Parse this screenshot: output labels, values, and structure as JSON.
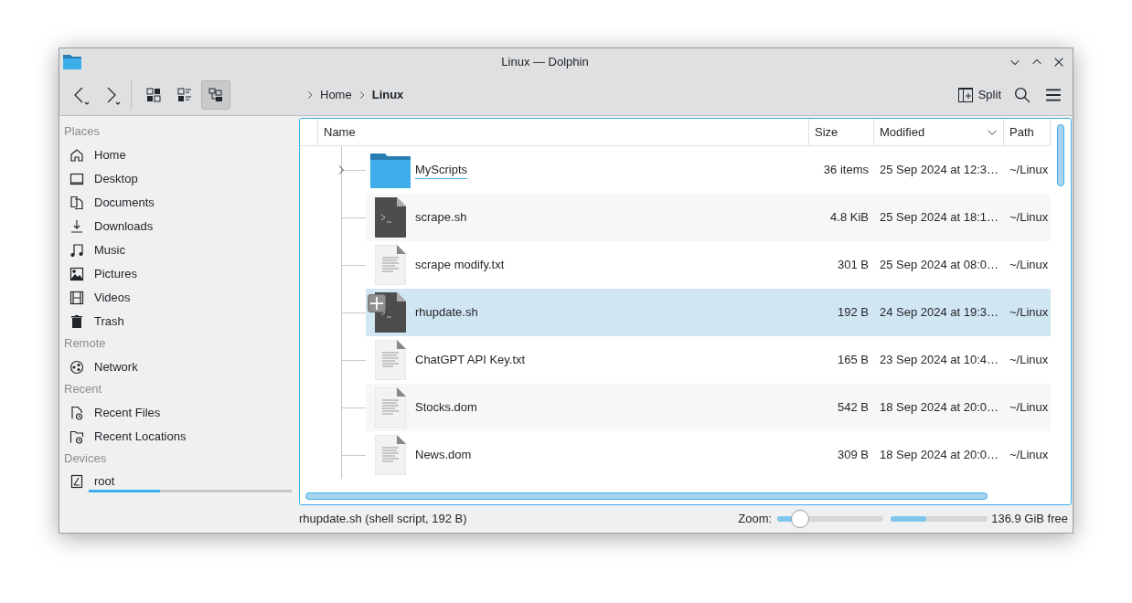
{
  "window": {
    "title": "Linux — Dolphin"
  },
  "toolbar": {
    "view_modes": [
      {
        "kind": "icons",
        "selected": false
      },
      {
        "kind": "compact",
        "selected": false
      },
      {
        "kind": "details",
        "selected": true
      }
    ],
    "breadcrumb": [
      {
        "label": "Home",
        "current": false
      },
      {
        "label": "Linux",
        "current": true
      }
    ],
    "split_label": "Split"
  },
  "sidebar": {
    "sections": [
      {
        "title": "Places",
        "items": [
          {
            "label": "Home",
            "kind": "home"
          },
          {
            "label": "Desktop",
            "kind": "desktop"
          },
          {
            "label": "Documents",
            "kind": "documents"
          },
          {
            "label": "Downloads",
            "kind": "downloads"
          },
          {
            "label": "Music",
            "kind": "music"
          },
          {
            "label": "Pictures",
            "kind": "pictures"
          },
          {
            "label": "Videos",
            "kind": "videos"
          },
          {
            "label": "Trash",
            "kind": "trash"
          }
        ]
      },
      {
        "title": "Remote",
        "items": [
          {
            "label": "Network",
            "kind": "network"
          }
        ]
      },
      {
        "title": "Recent",
        "items": [
          {
            "label": "Recent Files",
            "kind": "recent-files"
          },
          {
            "label": "Recent Locations",
            "kind": "recent-locations"
          }
        ]
      },
      {
        "title": "Devices",
        "items": [
          {
            "label": "root",
            "kind": "drive",
            "level": 0.35
          }
        ]
      }
    ]
  },
  "table": {
    "columns": [
      {
        "label": "Name",
        "sorted": false
      },
      {
        "label": "Size",
        "sorted": false
      },
      {
        "label": "Modified",
        "sorted": true
      },
      {
        "label": "Path",
        "sorted": false
      }
    ],
    "rows": [
      {
        "kind": "folder",
        "name": "MyScripts",
        "size": "36 items",
        "modified": "25 Sep 2024 at 12:3…",
        "path": "~/Linux",
        "selected": false,
        "expandable": true,
        "hovered": true
      },
      {
        "kind": "script",
        "name": "scrape.sh",
        "size": "4.8 KiB",
        "modified": "25 Sep 2024 at 18:1…",
        "path": "~/Linux",
        "selected": false,
        "expandable": false,
        "hovered": false
      },
      {
        "kind": "text",
        "name": "scrape modify.txt",
        "size": "301 B",
        "modified": "25 Sep 2024 at 08:0…",
        "path": "~/Linux",
        "selected": false,
        "expandable": false,
        "hovered": false
      },
      {
        "kind": "script",
        "name": "rhupdate.sh",
        "size": "192 B",
        "modified": "24 Sep 2024 at 19:3…",
        "path": "~/Linux",
        "selected": true,
        "expandable": false,
        "hovered": false
      },
      {
        "kind": "text",
        "name": "ChatGPT API Key.txt",
        "size": "165 B",
        "modified": "23 Sep 2024 at 10:4…",
        "path": "~/Linux",
        "selected": false,
        "expandable": false,
        "hovered": false
      },
      {
        "kind": "text",
        "name": "Stocks.dom",
        "size": "542 B",
        "modified": "18 Sep 2024 at 20:0…",
        "path": "~/Linux",
        "selected": false,
        "expandable": false,
        "hovered": false
      },
      {
        "kind": "text",
        "name": "News.dom",
        "size": "309 B",
        "modified": "18 Sep 2024 at 20:0…",
        "path": "~/Linux",
        "selected": false,
        "expandable": false,
        "hovered": false
      }
    ]
  },
  "status_bar": {
    "text": "rhupdate.sh (shell script, 192 B)",
    "zoom_label": "Zoom:",
    "zoom": {
      "level": 0.15
    },
    "disk": {
      "level": 0.37
    },
    "free": "136.9 GiB free"
  }
}
